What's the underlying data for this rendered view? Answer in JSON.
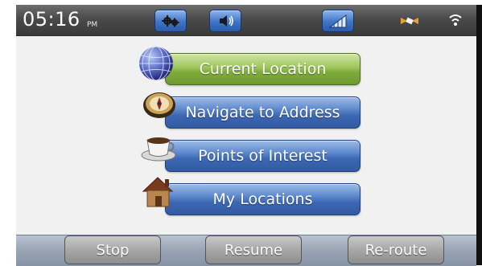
{
  "status_bar": {
    "time": "05:16",
    "ampm": "PM",
    "buttons": [
      {
        "icon": "settings-gears-icon"
      },
      {
        "icon": "volume-icon"
      },
      {
        "icon": "signal-bars-icon"
      }
    ],
    "status_icons": [
      {
        "icon": "satellite-icon"
      },
      {
        "icon": "wifi-icon"
      }
    ]
  },
  "menu": {
    "items": [
      {
        "label": "Current Location",
        "icon": "globe-icon",
        "active": true
      },
      {
        "label": "Navigate to Address",
        "icon": "compass-icon",
        "active": false
      },
      {
        "label": "Points of Interest",
        "icon": "coffee-cup-icon",
        "active": false
      },
      {
        "label": "My Locations",
        "icon": "house-icon",
        "active": false
      }
    ]
  },
  "bottom_bar": {
    "buttons": [
      {
        "label": "Stop"
      },
      {
        "label": "Resume"
      },
      {
        "label": "Re-route"
      }
    ]
  },
  "colors": {
    "active_green": "#8ab84a",
    "button_blue": "#4a78c0",
    "topbar_gray": "#555555",
    "bottom_gray": "#9aa6b6"
  }
}
